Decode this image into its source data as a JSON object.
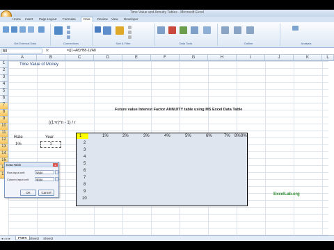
{
  "window": {
    "title": "Time Value and Annuity Tables - Microsoft Excel"
  },
  "ribbon": {
    "tabs": [
      "Home",
      "Insert",
      "Page Layout",
      "Formulas",
      "Data",
      "Review",
      "View",
      "Developer"
    ],
    "active_tab": "Data",
    "groups": [
      "Get External Data",
      "Connections",
      "Sort & Filter",
      "Data Tools",
      "Outline",
      "Analysis"
    ]
  },
  "formula_bar": {
    "name_box": "B8",
    "fx": "fx",
    "formula": "=((1+A8)^B8-1)/A8"
  },
  "columns": [
    "A",
    "B",
    "C",
    "D",
    "E",
    "F",
    "G",
    "H",
    "I",
    "J",
    "K",
    "L",
    "M",
    "N"
  ],
  "rows": [
    "1",
    "2",
    "3",
    "4",
    "5",
    "6",
    "7",
    "8",
    "9",
    "10",
    "11",
    "12",
    "13",
    "14",
    "15",
    "16",
    "17"
  ],
  "sheet": {
    "title": "Time Value of Money",
    "heading": "Future value Interest Factor ANNUITY table using MS Excel Data Table",
    "formula_display": "((1+r)^n - 1) / r",
    "rate_label": "Rate",
    "year_label": "Year",
    "rate_value": "1%",
    "year_value": "1",
    "rate_headers": [
      "1%",
      "2%",
      "3%",
      "4%",
      "5%",
      "6%",
      "7%",
      "8%",
      "9%"
    ],
    "year_rows": [
      "2",
      "3",
      "4",
      "5",
      "6",
      "7",
      "8",
      "9",
      "10"
    ],
    "corner_value": "1"
  },
  "dialog": {
    "title": "Data Table",
    "close": "x",
    "row_label": "Row input cell:",
    "row_value": "$A$8",
    "col_label": "Column input cell:",
    "col_value": "$B$8",
    "ok": "OK",
    "cancel": "Cancel"
  },
  "sheet_tabs": [
    "FVIFA",
    "Sheet2",
    "Sheet3"
  ],
  "active_sheet": "FVIFA",
  "watermark": "ExcelLab.org"
}
